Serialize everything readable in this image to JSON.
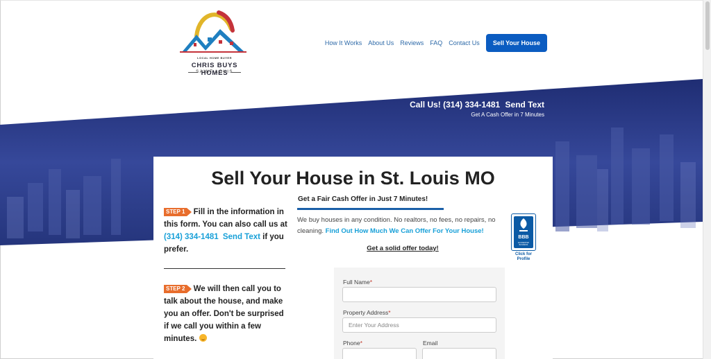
{
  "logo": {
    "tagline": "LOCAL HOME BUYER",
    "name": "CHRIS BUYS HOMES",
    "city": "SAINT LOUIS"
  },
  "nav": {
    "items": [
      "How It Works",
      "About Us",
      "Reviews",
      "FAQ",
      "Contact Us"
    ],
    "cta": "Sell Your House"
  },
  "hero": {
    "call_label": "Call Us! (314) 334-1481",
    "send_text": "Send Text",
    "subline": "Get A Cash Offer in 7 Minutes"
  },
  "main": {
    "title": "Sell Your House in St. Louis MO",
    "step1": {
      "tag": "STEP 1",
      "text_a": "Fill in the information in this form. You can also call us at",
      "phone": "(314) 334-1481",
      "send_text": "Send Text",
      "text_b": "if you prefer."
    },
    "step2": {
      "tag": "STEP 2",
      "text": "We will then call you to talk about the house, and make you an offer. Don't be surprised if we call you within a few minutes."
    },
    "offer": {
      "heading": "Get a Fair Cash Offer in Just 7 Minutes!",
      "body": "We buy houses in any condition. No realtors, no fees, no repairs, no cleaning.",
      "link": "Find Out How Much We Can Offer For Your House!",
      "cta": "Get a solid offer today!"
    },
    "bbb": {
      "logo_text": "BBB",
      "accredited": "ACCREDITED BUSINESS",
      "click": "Click for Profile"
    },
    "form": {
      "full_name_label": "Full Name",
      "address_label": "Property Address",
      "address_placeholder": "Enter Your Address",
      "phone_label": "Phone",
      "email_label": "Email",
      "required_mark": "*"
    }
  },
  "colors": {
    "nav_link": "#2e6aa8",
    "cta_button": "#0b5cc1",
    "hero_blue": "#26367f",
    "step_tag": "#e86d2c",
    "link": "#18a0d8"
  }
}
